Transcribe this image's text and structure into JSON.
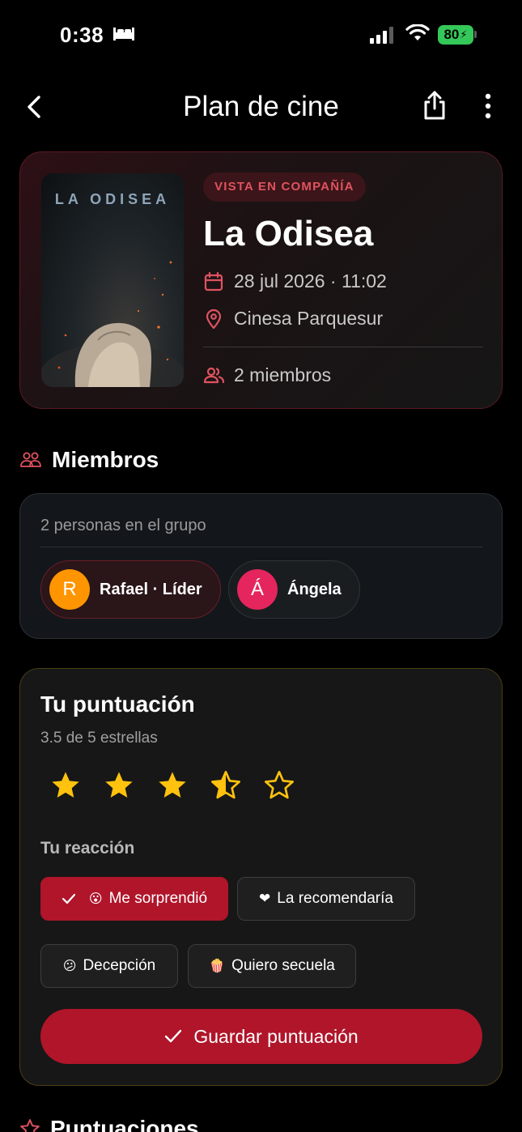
{
  "status_bar": {
    "time": "0:38",
    "battery": "80"
  },
  "header": {
    "title": "Plan de cine"
  },
  "movie": {
    "poster_title": "LA ODISEA",
    "badge": "VISTA EN COMPAÑÍA",
    "title": "La Odisea",
    "date_time": "28 jul 2026 · 11:02",
    "venue": "Cinesa Parquesur",
    "members_count": "2 miembros"
  },
  "members_section": {
    "heading": "Miembros",
    "subtitle": "2 personas en el grupo",
    "members": [
      {
        "initial": "R",
        "label": "Rafael · Líder",
        "color": "#ff9500"
      },
      {
        "initial": "Á",
        "label": "Ángela",
        "color": "#e5255d"
      }
    ]
  },
  "rating": {
    "title": "Tu puntuación",
    "subtitle": "3.5 de 5 estrellas",
    "value": 3.5,
    "max": 5,
    "star_color": "#ffc20e",
    "reaction_label": "Tu reacción",
    "reactions": [
      {
        "emoji": "😮",
        "label": "Me sorprendió",
        "selected": true
      },
      {
        "emoji": "❤",
        "label": "La recomendaría",
        "selected": false
      },
      {
        "emoji": "😕",
        "label": "Decepción",
        "selected": false
      },
      {
        "emoji": "🍿",
        "label": "Quiero secuela",
        "selected": false
      }
    ],
    "save_label": "Guardar puntuación"
  },
  "ratings_section": {
    "heading": "Puntuaciones"
  },
  "colors": {
    "accent": "#b0152a",
    "accent_text": "#e0535f",
    "background": "#000000"
  }
}
